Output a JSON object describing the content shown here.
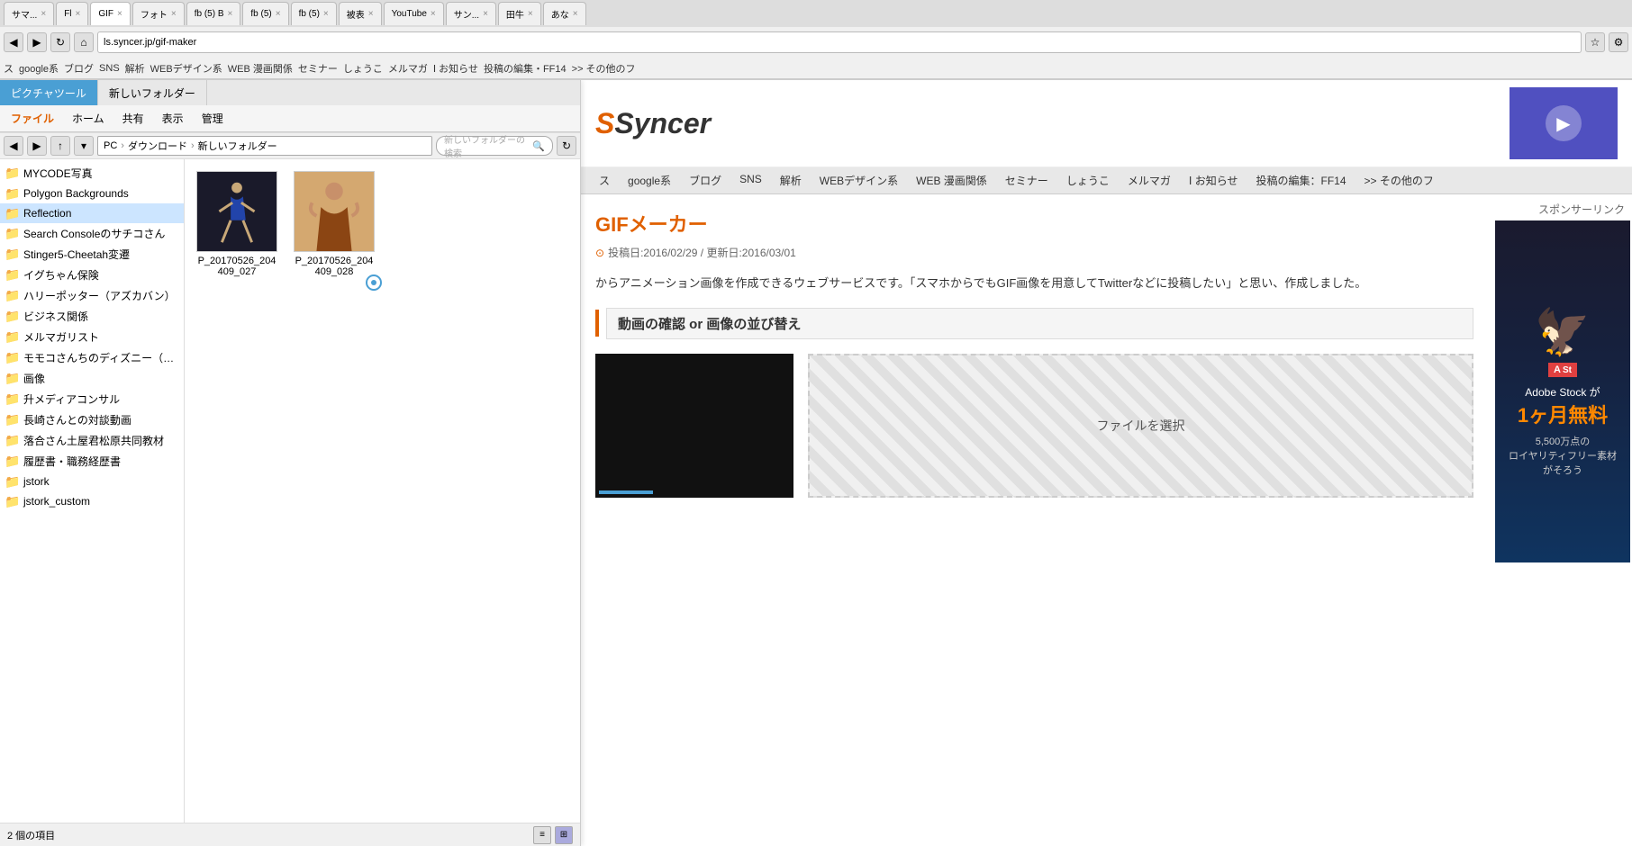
{
  "browser": {
    "tabs": [
      {
        "label": "サマ...",
        "active": false,
        "close": "×"
      },
      {
        "label": "Fl ×",
        "active": false
      },
      {
        "label": "GIF×",
        "active": true
      },
      {
        "label": "フォト×",
        "active": false
      },
      {
        "label": "fb (5) B×",
        "active": false
      },
      {
        "label": "fb (5) ×",
        "active": false
      },
      {
        "label": "fb (5) ×",
        "active": false
      },
      {
        "label": "被表×",
        "active": false
      },
      {
        "label": "YouTube ×",
        "active": false
      },
      {
        "label": "サン...×",
        "active": false
      },
      {
        "label": "田牛 ×",
        "active": false
      },
      {
        "label": "あな ×",
        "active": false
      }
    ],
    "address": "ls.syncer.jp/gif-maker",
    "bookmarks": [
      "ス",
      "google系",
      "ブログ",
      "SNS",
      "解析",
      "WEBデザイン系",
      "WEB 漫画関係",
      "セミナー",
      "しょうこ",
      "メルマガ",
      "Ⅰ お知らせ",
      "投稿の編集・FF14",
      "その他のフ"
    ]
  },
  "explorer": {
    "tabs": [
      {
        "label": "ピクチャツール",
        "active": true
      },
      {
        "label": "新しいフォルダー",
        "active": false
      }
    ],
    "menu": [
      "ファイル",
      "ホーム",
      "共有",
      "表示",
      "管理"
    ],
    "path": [
      "PC",
      "ダウンロード",
      "新しいフォルダー"
    ],
    "search_placeholder": "新しいフォルダーの検索",
    "sidebar_items": [
      {
        "label": "MYCODE写真",
        "color": "yellow"
      },
      {
        "label": "Polygon Backgrounds",
        "color": "yellow"
      },
      {
        "label": "Reflection",
        "color": "yellow"
      },
      {
        "label": "Search Consoleのサチコさん",
        "color": "yellow"
      },
      {
        "label": "Stinger5-Cheetah変遷",
        "color": "yellow"
      },
      {
        "label": "イグちゃん保険",
        "color": "yellow"
      },
      {
        "label": "ハリーポッター（アズカバン）",
        "color": "yellow"
      },
      {
        "label": "ビジネス関係",
        "color": "yellow"
      },
      {
        "label": "メルマガリスト",
        "color": "yellow"
      },
      {
        "label": "モモコさんちのディズニー（親子でデ",
        "color": "yellow"
      },
      {
        "label": "画像",
        "color": "red"
      },
      {
        "label": "升メディアコンサル",
        "color": "yellow"
      },
      {
        "label": "長崎さんとの対談動画",
        "color": "yellow"
      },
      {
        "label": "落合さん土屋君松原共同教材",
        "color": "yellow"
      },
      {
        "label": "履歴書・職務経歴書",
        "color": "yellow"
      },
      {
        "label": "jstork",
        "color": "yellow"
      },
      {
        "label": "jstork_custom",
        "color": "yellow"
      }
    ],
    "files": [
      {
        "name": "P_20170526_204409_027"
      },
      {
        "name": "P_20170526_204409_028"
      }
    ],
    "status": "2 個の項目"
  },
  "webpage": {
    "logo": "Syncer",
    "nav_items": [
      "ス",
      "google系",
      "ブログ",
      "SNS",
      "解析",
      "WEBデザイン系",
      "WEB 漫画関係",
      "セミナー",
      "しょうこ",
      "メルマガ",
      "0 お知らせ",
      "投稿の編集：FF14",
      ">> その他のフ"
    ],
    "page_title": "GIFメーカー",
    "post_meta": "投稿日:2016/02/29 / 更新日:2016/03/01",
    "description": "からアニメーション画像を作成できるウェブサービスです。「スマホからでもGIF画像を用意してTwitterなどに投稿したい」と思い、作成しました。",
    "section_title": "動画の確認 or 画像の並び替え",
    "upload_label": "ファイルを選択",
    "sponsor_label": "スポンサーリンク",
    "ad": {
      "logo": "Adobe",
      "title": "Adobe Stock が",
      "subtitle": "1ヶ月無料",
      "desc1": "5,500万点の",
      "desc2": "ロイヤリティフリー素材",
      "desc3": "がそろう"
    }
  }
}
